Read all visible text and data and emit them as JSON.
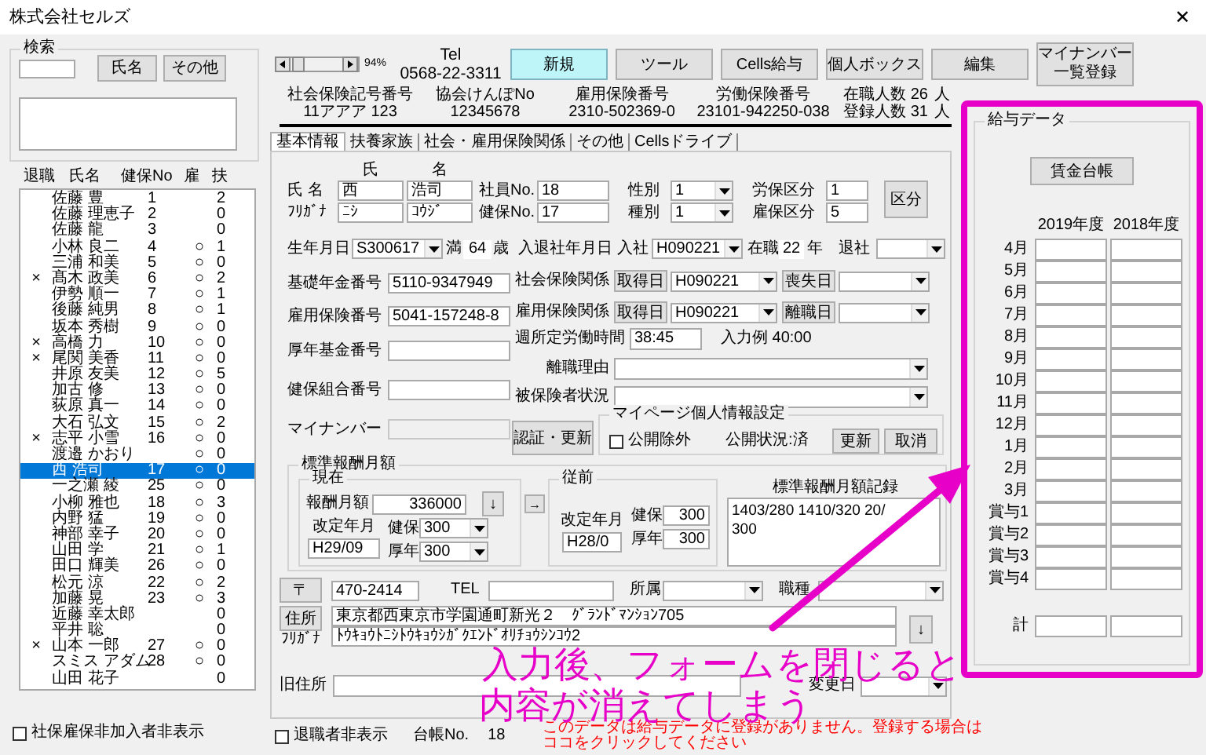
{
  "window": {
    "title": "株式会社セルズ",
    "close": "✕"
  },
  "search": {
    "label": "検索",
    "buttons": [
      "氏名",
      "その他"
    ]
  },
  "list": {
    "columns": [
      "退職",
      "氏名",
      "健保No",
      "雇",
      "扶"
    ],
    "rows": [
      {
        "name": "佐藤 豊",
        "no": "1",
        "fuyo": "2",
        "selected": false
      },
      {
        "name": "佐藤 理恵子",
        "no": "2",
        "fuyo": "0",
        "selected": false
      },
      {
        "name": "佐藤 龍",
        "no": "3",
        "fuyo": "0",
        "selected": false
      },
      {
        "name": "小林 良二",
        "no": "4",
        "koyo": "○",
        "fuyo": "1",
        "selected": false
      },
      {
        "name": "三浦 和美",
        "no": "5",
        "koyo": "○",
        "fuyo": "0",
        "selected": false
      },
      {
        "mark": "×",
        "name": "髙木 政美",
        "no": "6",
        "koyo": "○",
        "fuyo": "2",
        "selected": false
      },
      {
        "name": "伊勢 順一",
        "no": "7",
        "koyo": "○",
        "fuyo": "1",
        "selected": false
      },
      {
        "name": "後藤 純男",
        "no": "8",
        "koyo": "○",
        "fuyo": "1",
        "selected": false
      },
      {
        "name": "坂本 秀樹",
        "no": "9",
        "koyo": "○",
        "fuyo": "0",
        "selected": false
      },
      {
        "mark": "×",
        "name": "高橋 力",
        "no": "10",
        "koyo": "○",
        "fuyo": "0",
        "selected": false
      },
      {
        "mark": "×",
        "name": "尾関 美香",
        "no": "11",
        "koyo": "○",
        "fuyo": "0",
        "selected": false
      },
      {
        "name": "井原 友美",
        "no": "12",
        "koyo": "○",
        "fuyo": "5",
        "selected": false
      },
      {
        "name": "加古 修",
        "no": "13",
        "koyo": "○",
        "fuyo": "0",
        "selected": false
      },
      {
        "name": "荻原 真一",
        "no": "14",
        "koyo": "○",
        "fuyo": "0",
        "selected": false
      },
      {
        "name": "大石 弘文",
        "no": "15",
        "koyo": "○",
        "fuyo": "2",
        "selected": false
      },
      {
        "mark": "×",
        "name": "志平 小雪",
        "no": "16",
        "koyo": "○",
        "fuyo": "0",
        "selected": false
      },
      {
        "name": "渡邉 かおり",
        "koyo": "○",
        "fuyo": "0",
        "selected": false
      },
      {
        "name": "西 浩司",
        "no": "17",
        "koyo": "○",
        "fuyo": "0",
        "selected": true
      },
      {
        "name": "一之瀬 綾",
        "no": "25",
        "koyo": "○",
        "fuyo": "0",
        "selected": false
      },
      {
        "name": "小柳 雅也",
        "no": "18",
        "koyo": "○",
        "fuyo": "3",
        "selected": false
      },
      {
        "name": "内野 猛",
        "no": "19",
        "koyo": "○",
        "fuyo": "0",
        "selected": false
      },
      {
        "name": "神部 幸子",
        "no": "20",
        "koyo": "○",
        "fuyo": "0",
        "selected": false
      },
      {
        "name": "山田 学",
        "no": "21",
        "koyo": "○",
        "fuyo": "1",
        "selected": false
      },
      {
        "name": "田口 輝美",
        "no": "26",
        "koyo": "○",
        "fuyo": "0",
        "selected": false
      },
      {
        "name": "松元 涼",
        "no": "22",
        "koyo": "○",
        "fuyo": "2",
        "selected": false
      },
      {
        "name": "加藤 晃",
        "no": "23",
        "koyo": "○",
        "fuyo": "3",
        "selected": false
      },
      {
        "name": "近藤 幸太郎",
        "fuyo": "0",
        "selected": false
      },
      {
        "name": "平井 聡",
        "fuyo": "0",
        "selected": false
      },
      {
        "mark": "×",
        "name": "山本 一郎",
        "no": "27",
        "koyo": "○",
        "fuyo": "0",
        "selected": false
      },
      {
        "name": "スミス アダム",
        "no": "28",
        "koyo": "○",
        "fuyo": "0",
        "selected": false
      },
      {
        "name": "山田 花子",
        "fuyo": "0",
        "selected": false
      }
    ]
  },
  "hide_uninsured": {
    "label": "社保雇保非加入者非表示",
    "checked": false
  },
  "zoom": "94%",
  "tel": {
    "label": "Tel",
    "number": "0568-22-3311"
  },
  "toolbar": [
    {
      "label": "新規",
      "highlighted": true
    },
    {
      "label": "ツール",
      "highlighted": false
    },
    {
      "label": "Cells給与",
      "highlighted": false
    },
    {
      "label": "個人ボックス",
      "highlighted": false
    },
    {
      "label": "編集",
      "highlighted": false
    },
    {
      "label": "マイナンバー一覧登録",
      "highlighted": false
    }
  ],
  "info": [
    {
      "label": "社会保険記号番号",
      "value": "11アアア 123"
    },
    {
      "label": "協会けんぽNo",
      "value": "12345678"
    },
    {
      "label": "雇用保険番号",
      "value": "2310-502369-0"
    },
    {
      "label": "労働保険番号",
      "value": "23101-942250-038"
    }
  ],
  "counts": [
    {
      "label": "在職人数",
      "value": "26",
      "unit": "人"
    },
    {
      "label": "登録人数",
      "value": "31",
      "unit": "人"
    }
  ],
  "tabs": [
    {
      "label": "基本情報",
      "selected": true
    },
    {
      "label": "扶養家族",
      "selected": false
    },
    {
      "label": "社会・雇用保険関係",
      "selected": false
    },
    {
      "label": "その他",
      "selected": false
    },
    {
      "label": "Cellsドライブ",
      "selected": false
    }
  ],
  "basic": {
    "name_headers": [
      "氏",
      "名"
    ],
    "name": {
      "label": "氏 名",
      "last": "西",
      "first": "浩司"
    },
    "kana": {
      "label": "ﾌﾘｶﾞﾅ",
      "last": "ﾆｼ",
      "first": "ｺｳｼﾞ"
    },
    "employee_no": {
      "label": "社員No.",
      "value": "18"
    },
    "kenpo_no": {
      "label": "健保No.",
      "value": "17"
    },
    "gender": {
      "label": "性別",
      "value": "1"
    },
    "category": {
      "label": "種別",
      "value": "1"
    },
    "rouho": {
      "label": "労保区分",
      "value": "1"
    },
    "koho": {
      "label": "雇保区分",
      "value": "5"
    },
    "kubun_button": "区分",
    "birth": {
      "label": "生年月日",
      "value": "S300617",
      "age_prefix": "満",
      "age": "64",
      "age_unit": "歳"
    },
    "employment": {
      "label": "入退社年月日",
      "join_label": "入社",
      "join": "H090221",
      "tenure_prefix": "在職",
      "tenure": "22",
      "tenure_unit": "年",
      "leave_label": "退社"
    },
    "left_fields": [
      {
        "label": "基礎年金番号",
        "value": "5110-9347949",
        "disabled": false
      },
      {
        "label": "雇用保険番号",
        "value": "5041-157248-8",
        "disabled": false
      },
      {
        "label": "厚年基金番号",
        "disabled": false
      },
      {
        "label": "健保組合番号",
        "disabled": false
      },
      {
        "label": "マイナンバー",
        "disabled": true
      }
    ],
    "insurance": [
      {
        "label": "社会保険関係",
        "get_button": "取得日",
        "get_date": "H090221",
        "lose_button": "喪失日"
      },
      {
        "label": "雇用保険関係",
        "get_button": "取得日",
        "get_date": "H090221",
        "lose_button": "離職日"
      }
    ],
    "weekly_hours": {
      "label": "週所定労働時間",
      "value": "38:45",
      "hint": "入力例 40:00"
    },
    "reason": {
      "label": "離職理由"
    },
    "status": {
      "label": "被保険者状況"
    },
    "auth_button": "認証・更新",
    "mypage": {
      "title": "マイページ個人情報設定",
      "exclude": {
        "label": "公開除外",
        "checked": false
      },
      "status": "公開状況:済",
      "buttons": [
        "更新",
        "取消"
      ]
    }
  },
  "standard": {
    "title": "標準報酬月額",
    "current": {
      "title": "現在",
      "amount_label": "報酬月額",
      "amount": "336000",
      "down": "↓",
      "revised_label": "改定年月",
      "revised": "H29/09",
      "kenpo_label": "健保",
      "kenpo": "300",
      "kounen_label": "厚年",
      "kounen": "300"
    },
    "copy": "→",
    "previous": {
      "title": "従前",
      "revised_label": "改定年月",
      "revised": "H28/0",
      "kenpo_label": "健保",
      "kenpo": "300",
      "kounen_label": "厚年",
      "kounen": "300"
    },
    "record": {
      "title": "標準報酬月額記録",
      "lines": [
        "1403/280 1410/320 20/",
        "300"
      ]
    }
  },
  "address": {
    "zip_button": "〒",
    "zip": "470-2414",
    "tel_label": "TEL",
    "dept_label": "所属",
    "job_label": "職種",
    "address_button": "住所",
    "address": "東京都西東京市学園通町新光２　ｸﾞﾗﾝﾄﾞﾏﾝｼｮﾝ705",
    "kana_label": "ﾌﾘｶﾞﾅ",
    "kana": "ﾄｳｷｮｳﾄﾆｼﾄｳｷｮｳｼｶﾞｸｴﾝﾄﾞｵﾘﾁｮｳｼﾝｺｳ2",
    "down": "↓",
    "old_label": "旧住所",
    "changed_label": "変更日"
  },
  "salary": {
    "title": "給与データ",
    "button": "賃金台帳",
    "years": [
      "2019年度",
      "2018年度"
    ],
    "rows": [
      "4月",
      "5月",
      "6月",
      "7月",
      "8月",
      "9月",
      "10月",
      "11月",
      "12月",
      "1月",
      "2月",
      "3月",
      "賞与1",
      "賞与2",
      "賞与3",
      "賞与4"
    ],
    "total": "計"
  },
  "hide_retired": {
    "label": "退職者非表示",
    "checked": false
  },
  "ledger": {
    "label": "台帳No.",
    "value": "18"
  },
  "notice": "このデータは給与データに登録がありません。登録する場合はココをクリックしてください",
  "annotation": [
    "入力後、フォームを閉じると",
    "内容が消えてしまう"
  ]
}
